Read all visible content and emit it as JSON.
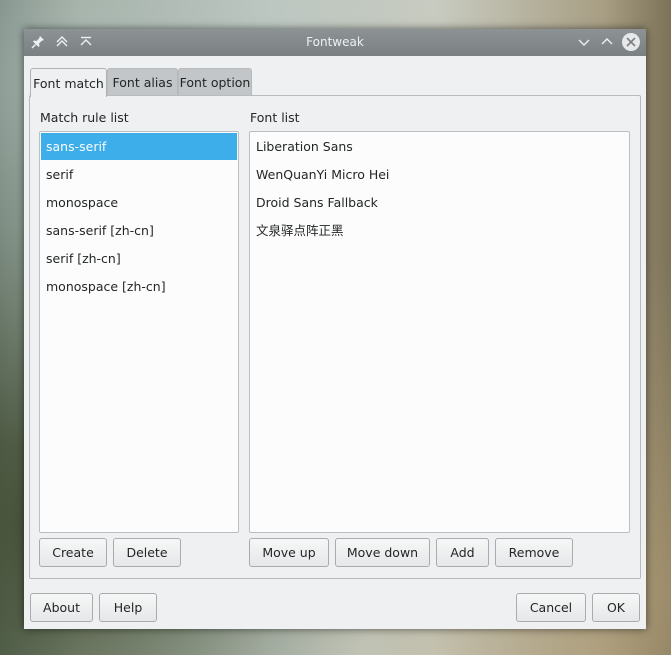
{
  "window": {
    "title": "Fontweak"
  },
  "titlebar_icons": [
    "pin-icon",
    "keep-above-icon",
    "keep-below-icon"
  ],
  "titlebar_controls": [
    "minimize-icon",
    "maximize-icon",
    "close-icon"
  ],
  "tabs": [
    {
      "label": "Font match",
      "active": true
    },
    {
      "label": "Font alias",
      "active": false
    },
    {
      "label": "Font option",
      "active": false
    }
  ],
  "match_rules": {
    "label": "Match rule list",
    "items": [
      "sans-serif",
      "serif",
      "monospace",
      "sans-serif [zh-cn]",
      "serif [zh-cn]",
      "monospace [zh-cn]"
    ],
    "selected": "sans-serif",
    "buttons": {
      "create": "Create",
      "delete": "Delete"
    }
  },
  "fonts": {
    "label": "Font list",
    "items": [
      "Liberation Sans",
      "WenQuanYi Micro Hei",
      "Droid Sans Fallback",
      "文泉驿点阵正黑"
    ],
    "buttons": {
      "move_up": "Move up",
      "move_down": "Move down",
      "add": "Add",
      "remove": "Remove"
    }
  },
  "dialog_buttons": {
    "about": "About",
    "help": "Help",
    "cancel": "Cancel",
    "ok": "OK"
  },
  "colors": {
    "selection": "#3daee9",
    "titlebar": "#848a8d",
    "window_bg": "#eff0f1"
  }
}
